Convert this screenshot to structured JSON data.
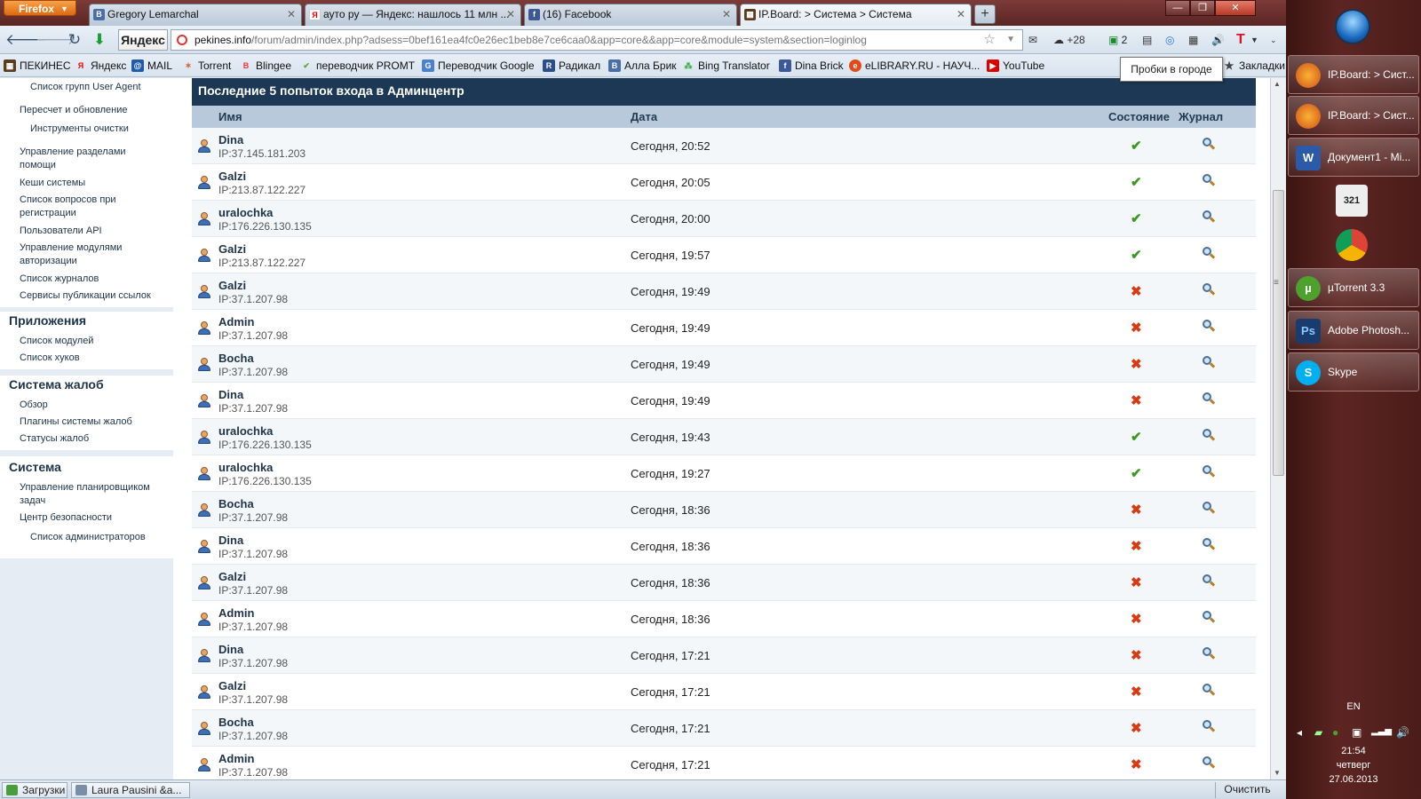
{
  "browser": {
    "menu_button": "Firefox",
    "tabs": [
      {
        "label": "Gregory Lemarchal",
        "icon": "B"
      },
      {
        "label": "ауто ру — Яндекс: нашлось 11 млн ...",
        "icon": "Я"
      },
      {
        "label": "(16) Facebook",
        "icon": "f"
      },
      {
        "label": "IP.Board: > Система > Система",
        "icon": "▦"
      }
    ],
    "yandex_label": "Яндекс",
    "url_host": "pekines.info",
    "url_path": "/forum/admin/index.php?adsess=0bef161ea4fc0e26ec1beb8e7ce6caa0&app=core&&app=core&module=system&section=loginlog",
    "weather": "+28",
    "badge_count": "2",
    "bookmarks": [
      "ПЕКИНЕС",
      "Яндекс",
      "MAIL",
      "Torrent",
      "Blingee",
      "переводчик  PROMT",
      "Переводчик Google",
      "Радикал",
      "Алла Брик",
      "Bing Translator",
      "Dina Brick",
      "eLIBRARY.RU - НАУЧ...",
      "YouTube"
    ],
    "bookmarks_menu": "Закладки",
    "tooltip": "Пробки в городе",
    "status_downloads": "Загрузки",
    "status_tab": "Laura Pausini &a...",
    "status_clear": "Очистить"
  },
  "sidebar": {
    "top_items": [
      {
        "label": "Список групп User Agent",
        "sub": true
      },
      {
        "label": "Пересчет и обновление",
        "sub": false
      },
      {
        "label": "Инструменты очистки",
        "sub": true
      },
      {
        "label": "Управление разделами помощи",
        "sub": false
      },
      {
        "label": "Кеши системы",
        "sub": false
      },
      {
        "label": "Список вопросов при регистрации",
        "sub": false
      },
      {
        "label": "Пользователи API",
        "sub": false
      },
      {
        "label": "Управление модулями авторизации",
        "sub": false
      },
      {
        "label": "Список журналов",
        "sub": false
      },
      {
        "label": "Сервисы публикации ссылок",
        "sub": false
      }
    ],
    "sections": [
      {
        "title": "Приложения",
        "items": [
          "Список модулей",
          "Список хуков"
        ]
      },
      {
        "title": "Система жалоб",
        "items": [
          "Обзор",
          "Плагины системы жалоб",
          "Статусы жалоб"
        ]
      },
      {
        "title": "Система",
        "items": [
          "Управление планировщиком задач",
          "Центр безопасности",
          "Список администраторов"
        ]
      }
    ]
  },
  "table": {
    "title": "Последние 5 попыток входа в Админцентр",
    "columns": {
      "name": "Имя",
      "date": "Дата",
      "status": "Состояние",
      "log": "Журнал"
    },
    "rows": [
      {
        "name": "Dina",
        "ip": "IP:37.145.181.203",
        "date": "Сегодня, 20:52",
        "success": true
      },
      {
        "name": "Galzi",
        "ip": "IP:213.87.122.227",
        "date": "Сегодня, 20:05",
        "success": true
      },
      {
        "name": "uralochka",
        "ip": "IP:176.226.130.135",
        "date": "Сегодня, 20:00",
        "success": true
      },
      {
        "name": "Galzi",
        "ip": "IP:213.87.122.227",
        "date": "Сегодня, 19:57",
        "success": true
      },
      {
        "name": "Galzi",
        "ip": "IP:37.1.207.98",
        "date": "Сегодня, 19:49",
        "success": false
      },
      {
        "name": "Admin",
        "ip": "IP:37.1.207.98",
        "date": "Сегодня, 19:49",
        "success": false
      },
      {
        "name": "Bocha",
        "ip": "IP:37.1.207.98",
        "date": "Сегодня, 19:49",
        "success": false
      },
      {
        "name": "Dina",
        "ip": "IP:37.1.207.98",
        "date": "Сегодня, 19:49",
        "success": false
      },
      {
        "name": "uralochka",
        "ip": "IP:176.226.130.135",
        "date": "Сегодня, 19:43",
        "success": true
      },
      {
        "name": "uralochka",
        "ip": "IP:176.226.130.135",
        "date": "Сегодня, 19:27",
        "success": true
      },
      {
        "name": "Bocha",
        "ip": "IP:37.1.207.98",
        "date": "Сегодня, 18:36",
        "success": false
      },
      {
        "name": "Dina",
        "ip": "IP:37.1.207.98",
        "date": "Сегодня, 18:36",
        "success": false
      },
      {
        "name": "Galzi",
        "ip": "IP:37.1.207.98",
        "date": "Сегодня, 18:36",
        "success": false
      },
      {
        "name": "Admin",
        "ip": "IP:37.1.207.98",
        "date": "Сегодня, 18:36",
        "success": false
      },
      {
        "name": "Dina",
        "ip": "IP:37.1.207.98",
        "date": "Сегодня, 17:21",
        "success": false
      },
      {
        "name": "Galzi",
        "ip": "IP:37.1.207.98",
        "date": "Сегодня, 17:21",
        "success": false
      },
      {
        "name": "Bocha",
        "ip": "IP:37.1.207.98",
        "date": "Сегодня, 17:21",
        "success": false
      },
      {
        "name": "Admin",
        "ip": "IP:37.1.207.98",
        "date": "Сегодня, 17:21",
        "success": false
      }
    ]
  },
  "taskbar": {
    "windows": [
      {
        "label": "IP.Board: > Сист...",
        "icon": "firefox-icon"
      },
      {
        "label": "IP.Board: > Сист...",
        "icon": "firefox-icon"
      },
      {
        "label": "Документ1 - Mi...",
        "icon": "word-icon"
      },
      {
        "label": "µTorrent 3.3",
        "icon": "utorrent-icon"
      },
      {
        "label": "Adobe Photosh...",
        "icon": "photoshop-icon"
      },
      {
        "label": "Skype",
        "icon": "skype-icon"
      }
    ],
    "pinned_media": "321",
    "lang": "EN",
    "time": "21:54",
    "day": "четверг",
    "date": "27.06.2013"
  },
  "colors": {
    "success": "#3a9a1f",
    "failure": "#d63b15",
    "header": "#1d3855"
  }
}
